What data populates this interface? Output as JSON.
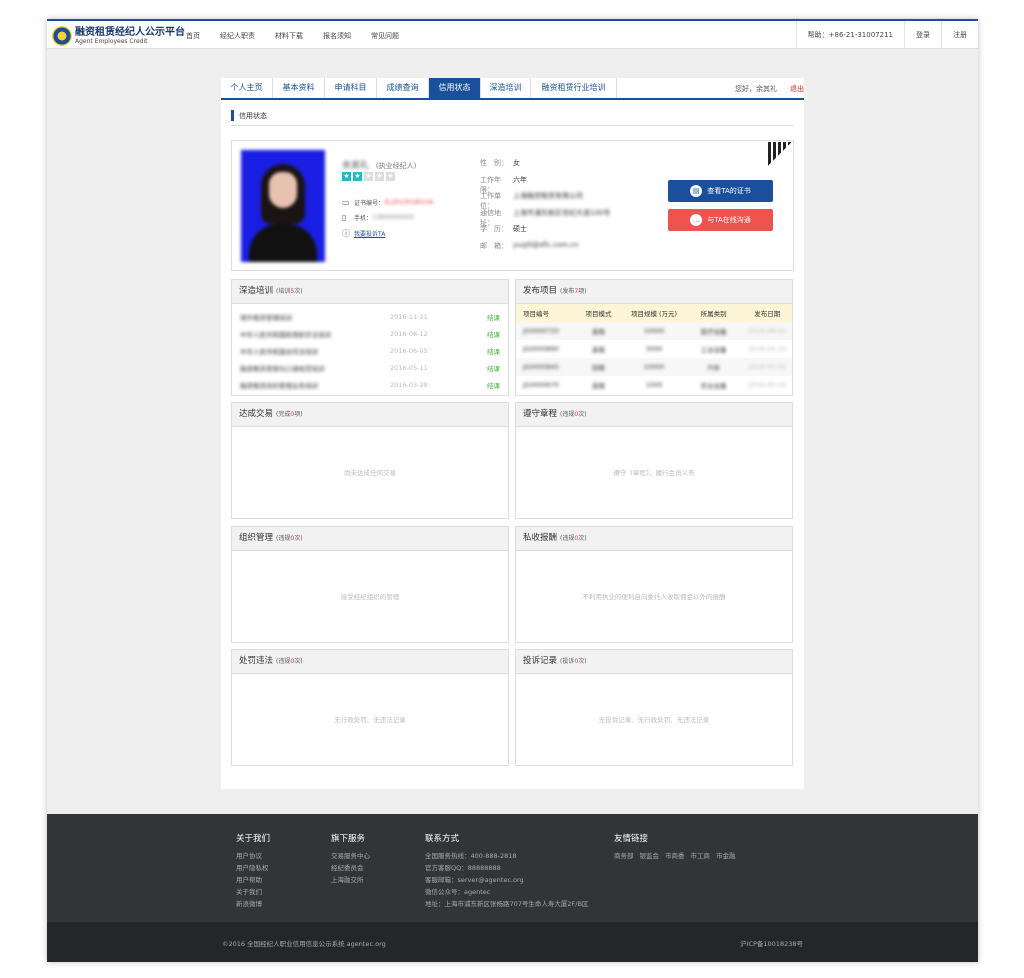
{
  "header": {
    "logo_cn": "融资租赁经纪人公示平台",
    "logo_en": "Agent Employees Credit",
    "nav": [
      "首页",
      "经纪人职责",
      "材料下载",
      "报名须知",
      "常见问题"
    ],
    "help": "帮助：+86-21-31007211",
    "login": "登录",
    "register": "注册"
  },
  "tabs": [
    "个人主页",
    "基本资料",
    "申请科目",
    "成绩查询",
    "信用状态",
    "深造培训",
    "融资租赁行业培训"
  ],
  "active_tab": "信用状态",
  "greeting": "您好，余其礼",
  "logout": "退出",
  "section_title": "信用状态",
  "profile": {
    "name": "余其礼",
    "rank": "(执业经纪人)",
    "stars_on": 2,
    "stars_total": 5,
    "cert_label": "证书编号：",
    "cert_value": "ZL20130180156",
    "phone_label": "手机：",
    "phone_value": "13800000000",
    "complain_link": "我要投诉TA",
    "fields": [
      {
        "k": "性　别：",
        "v": "女"
      },
      {
        "k": "工作年限：",
        "v": "六年"
      },
      {
        "k": "工作单位：",
        "v": "上海融资租赁有限公司"
      },
      {
        "k": "通信地址：",
        "v": "上海市浦东新区世纪大道100号"
      },
      {
        "k": "学　历：",
        "v": "硕士"
      },
      {
        "k": "邮　箱：",
        "v": "yuqili@sflc.com.cn"
      }
    ],
    "btn_cert": "查看TA的证书",
    "btn_chat": "与TA在线沟通"
  },
  "training": {
    "title": "深造培训",
    "count_prefix": "(培训",
    "count": "5",
    "count_suffix": "次)",
    "rows": [
      {
        "t": "境外租赁管理培训",
        "d": "2016-11-21",
        "s": "结课"
      },
      {
        "t": "中华人民共和国民用航空法培训",
        "d": "2016-08-12",
        "s": "结课"
      },
      {
        "t": "中华人民共和国合同法培训",
        "d": "2016-06-05",
        "s": "结课"
      },
      {
        "t": "融资租赁营销与口语规范培训",
        "d": "2016-05-11",
        "s": "结课"
      },
      {
        "t": "融资租赁风险管理业务培训",
        "d": "2016-03-28",
        "s": "结课"
      }
    ]
  },
  "projects": {
    "title": "发布项目",
    "count_prefix": "(发布",
    "count": "7",
    "count_suffix": "项)",
    "headers": [
      "项目编号",
      "项目模式",
      "项目规模 (万元)",
      "所属类别",
      "发布日期"
    ],
    "rows": [
      [
        "JG0000720",
        "直租",
        "10000",
        "医疗设备",
        "2016-08-01"
      ],
      [
        "JG0000890",
        "直租",
        "3000",
        "工业设备",
        "2016-06-15"
      ],
      [
        "JG0000845",
        "回租",
        "10000",
        "汽车",
        "2016-05-21"
      ],
      [
        "JG0000670",
        "直租",
        "1000",
        "农业设备",
        "2016-05-16"
      ]
    ]
  },
  "panels": [
    {
      "title": "达成交易",
      "prefix": "(完成",
      "count": "0",
      "suffix": "项)",
      "empty": "尚未达成任何交易"
    },
    {
      "title": "遵守章程",
      "prefix": "(违规",
      "count": "0",
      "suffix": "次)",
      "empty": "遵守《章程》，履行会员义务"
    },
    {
      "title": "组织管理",
      "prefix": "(违规",
      "count": "0",
      "suffix": "次)",
      "empty": "接受经纪组织的管理"
    },
    {
      "title": "私收报酬",
      "prefix": "(违规",
      "count": "0",
      "suffix": "次)",
      "empty": "不利用执业的便利自向委托人收取佣金以外的报酬"
    },
    {
      "title": "处罚违法",
      "prefix": "(违规",
      "count": "0",
      "suffix": "次)",
      "empty": "无行政处罚、无违法记录"
    },
    {
      "title": "投诉记录",
      "prefix": "(投诉",
      "count": "0",
      "suffix": "次)",
      "empty": "无投诉记录、无行政处罚、无违法记录"
    }
  ],
  "footer": {
    "about": {
      "title": "关于我们",
      "items": [
        "用户协议",
        "用户隐私权",
        "用户帮助",
        "关于我们",
        "新浪微博"
      ]
    },
    "services": {
      "title": "旗下服务",
      "items": [
        "交易服务中心",
        "经纪委员会",
        "上海融交所"
      ]
    },
    "contact": {
      "title": "联系方式",
      "items": [
        "全国服务热线：400-888-2818",
        "官方客服QQ：88888888",
        "客服邮箱：server@agentec.org",
        "微信公众号：agentec",
        "地址：上海市浦东新区张杨路707号生命人寿大厦2F/B区"
      ]
    },
    "links": {
      "title": "友情链接",
      "items": [
        "商务部",
        "银监会",
        "市商委",
        "市工商",
        "市金融"
      ]
    },
    "copyright": "©2016  全国经纪人职业信用信息公示系统  agentec.org",
    "icp": "沪ICP备10018238号"
  }
}
